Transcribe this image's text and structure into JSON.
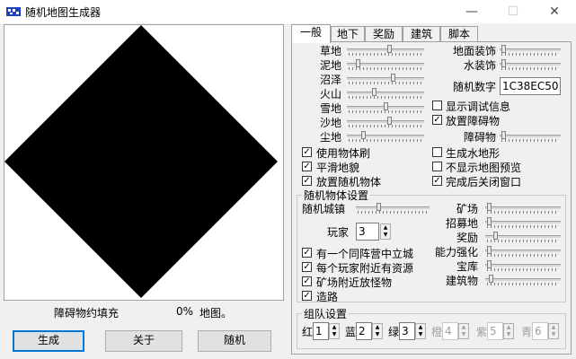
{
  "window": {
    "title": "随机地图生成器"
  },
  "titlebar": {
    "minimize": "—",
    "maximize": "☐",
    "close": "✕"
  },
  "status": {
    "fill_label": "障碍物约填充",
    "percent": "0%",
    "map_label": "地图。"
  },
  "buttons": {
    "generate": "生成",
    "about": "关于",
    "random": "随机"
  },
  "tabs": [
    "一般",
    "地下",
    "奖励",
    "建筑",
    "脚本"
  ],
  "terrain": {
    "labels": [
      "草地",
      "泥地",
      "沼泽",
      "火山",
      "雪地",
      "沙地",
      "尘地"
    ],
    "values": [
      0.55,
      0.12,
      0.6,
      0.35,
      0.5,
      0.55,
      0.2
    ]
  },
  "decor": {
    "ground_label": "地面装饰",
    "ground_value": 0.03,
    "water_label": "水装饰",
    "water_value": 0.03
  },
  "seed": {
    "label": "随机数字",
    "value": "1C38EC50"
  },
  "options_right": [
    {
      "label": "显示调试信息",
      "checked": false
    },
    {
      "label": "放置障碍物",
      "checked": true
    }
  ],
  "obstacle": {
    "label": "障碍物",
    "value": 0.03
  },
  "options_main": [
    {
      "label": "使用物体刷",
      "checked": true
    },
    {
      "label": "平滑地貌",
      "checked": true
    },
    {
      "label": "放置随机物体",
      "checked": true
    }
  ],
  "options_main_right": [
    {
      "label": "生成水地形",
      "checked": false
    },
    {
      "label": "不显示地图预览",
      "checked": false
    },
    {
      "label": "完成后关闭窗口",
      "checked": true
    }
  ],
  "random_objects": {
    "title": "随机物体设置",
    "town_label": "随机城镇",
    "town_value": 0.3,
    "players_label": "玩家",
    "players_value": "3",
    "right_labels": [
      "矿场",
      "招募地",
      "奖励",
      "能力强化",
      "宝库",
      "建筑物"
    ],
    "right_values": [
      0.02,
      0.02,
      0.12,
      0.02,
      0.02,
      0.05
    ],
    "checks": [
      {
        "label": "有一个同阵营中立城",
        "checked": true
      },
      {
        "label": "每个玩家附近有资源",
        "checked": true
      },
      {
        "label": "矿场附近放怪物",
        "checked": true
      },
      {
        "label": "造路",
        "checked": true
      }
    ]
  },
  "teams": {
    "title": "组队设置",
    "items": [
      {
        "label": "红",
        "value": "1",
        "enabled": true
      },
      {
        "label": "蓝",
        "value": "2",
        "enabled": true
      },
      {
        "label": "绿",
        "value": "3",
        "enabled": true
      },
      {
        "label": "橙",
        "value": "4",
        "enabled": false
      },
      {
        "label": "紫",
        "value": "5",
        "enabled": false
      },
      {
        "label": "青",
        "value": "6",
        "enabled": false
      }
    ]
  }
}
